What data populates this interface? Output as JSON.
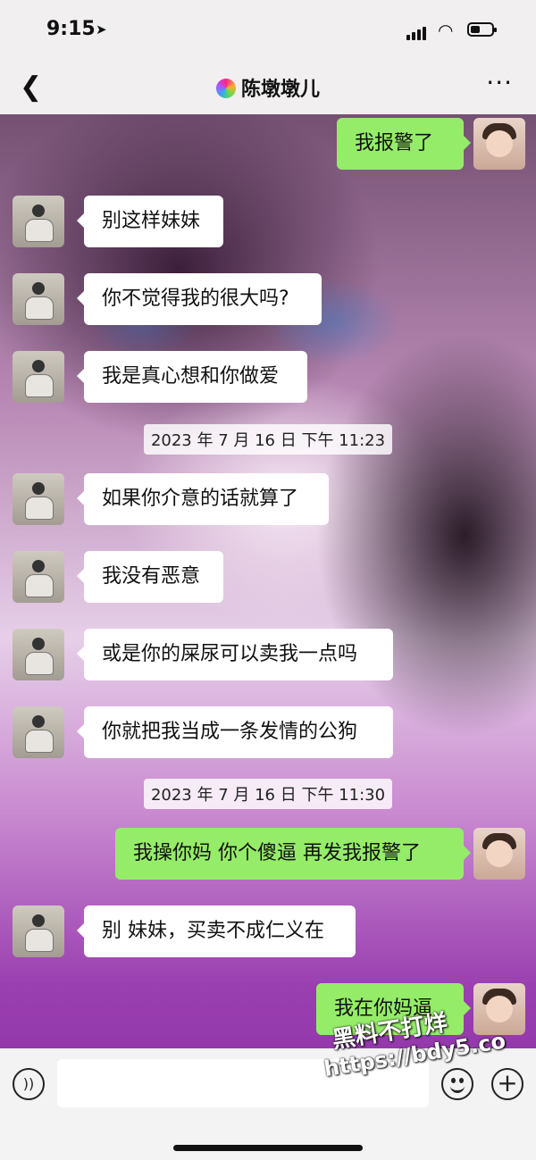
{
  "status": {
    "time": "9:15",
    "location_icon": "location-arrow-icon"
  },
  "header": {
    "title": "陈墩墩儿",
    "back_icon": "chevron-left-icon",
    "more_icon": "more-dots-icon",
    "more_label": "···"
  },
  "messages": [
    {
      "side": "out",
      "text": "我报警了"
    },
    {
      "side": "in",
      "text": "别这样妹妹"
    },
    {
      "side": "in",
      "text": "你不觉得我的很大吗?"
    },
    {
      "side": "in",
      "text": "我是真心想和你做爱"
    },
    {
      "type": "time",
      "text": "2023 年 7 月 16 日  下午 11:23"
    },
    {
      "side": "in",
      "text": "如果你介意的话就算了"
    },
    {
      "side": "in",
      "text": "我没有恶意"
    },
    {
      "side": "in",
      "text": "或是你的屎尿可以卖我一点吗"
    },
    {
      "side": "in",
      "text": "你就把我当成一条发情的公狗"
    },
    {
      "type": "time",
      "text": "2023 年 7 月 16 日  下午 11:30"
    },
    {
      "side": "out",
      "text": "我操你妈 你个傻逼 再发我报警了"
    },
    {
      "side": "in",
      "text": "别 妹妹，买卖不成仁义在"
    },
    {
      "side": "out",
      "text": "我在你妈逼"
    }
  ],
  "inputbar": {
    "voice_label": "))",
    "placeholder": "",
    "plus_label": "+"
  },
  "watermark": {
    "line1": "黑料不打烊",
    "line2": "https://bdy5.co"
  },
  "colors": {
    "outgoing_bubble": "#95ec69",
    "incoming_bubble": "#ffffff",
    "bar": "#f1efef"
  }
}
